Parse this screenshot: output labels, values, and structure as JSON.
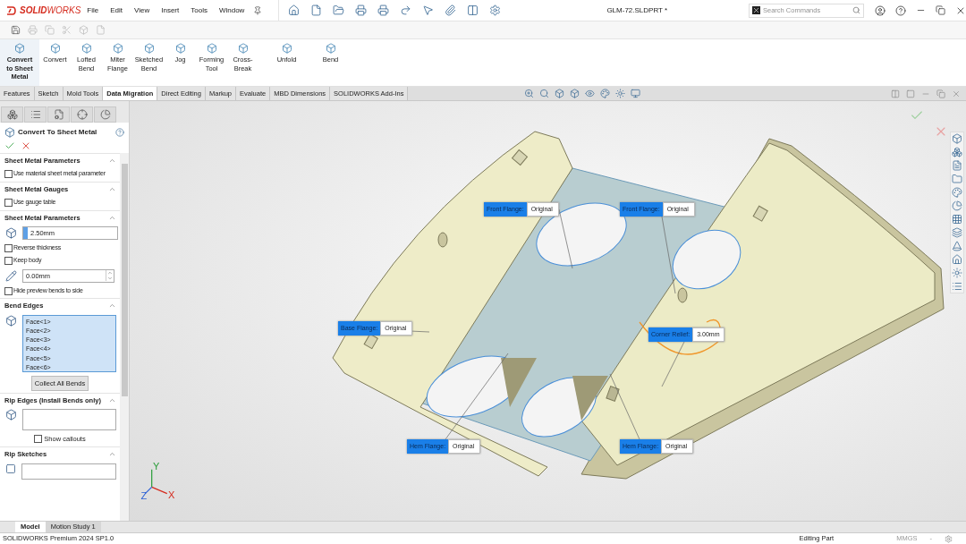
{
  "app": {
    "logo": "**SOLID**WORKS",
    "menu": [
      "File",
      "Edit",
      "View",
      "Insert",
      "Tools",
      "Window"
    ],
    "document_title": "GLM-72.SLDPRT *",
    "search": {
      "placeholder": "Search Commands"
    }
  },
  "ribbon": [
    {
      "label": "Convert to Sheet Metal",
      "selected": true
    },
    {
      "label": "Convert",
      "selected": false
    },
    {
      "label": "Lofted Bend",
      "selected": false
    },
    {
      "label": "Miter Flange",
      "selected": false
    },
    {
      "label": "Sketched Bend",
      "selected": false
    },
    {
      "label": "Jog",
      "selected": false
    },
    {
      "label": "Forming Tool",
      "selected": false
    },
    {
      "label": "Cross-Break",
      "selected": false
    },
    {
      "label": "Unfold",
      "selected": false
    },
    {
      "label": "Bend",
      "selected": false
    }
  ],
  "tabs": [
    {
      "label": "Features",
      "selected": false
    },
    {
      "label": "Sketch",
      "selected": false
    },
    {
      "label": "Mold Tools",
      "selected": false
    },
    {
      "label": "Data Migration",
      "selected": true
    },
    {
      "label": "Direct Editing",
      "selected": false
    },
    {
      "label": "Markup",
      "selected": false
    },
    {
      "label": "Evaluate",
      "selected": false
    },
    {
      "label": "MBD Dimensions",
      "selected": false
    },
    {
      "label": "SOLIDWORKS Add-Ins",
      "selected": false
    }
  ],
  "property_manager": {
    "title": "Convert To Sheet Metal",
    "sections": [
      {
        "title": "Sheet Metal Parameters",
        "expanded": true,
        "rows": [
          {
            "kind": "checkbox",
            "label": "Use material sheet metal parameter",
            "checked": false
          }
        ]
      },
      {
        "title": "Sheet Metal Gauges",
        "expanded": true,
        "rows": [
          {
            "kind": "checkbox",
            "label": "Use gauge table",
            "checked": false
          }
        ]
      },
      {
        "title": "Sheet Metal Parameters",
        "expanded": true,
        "rows": [
          {
            "kind": "field",
            "value": "2.50mm"
          },
          {
            "kind": "checkbox",
            "label": "Reverse thickness",
            "checked": false
          },
          {
            "kind": "checkbox",
            "label": "Keep body",
            "checked": false
          },
          {
            "kind": "spin",
            "value": "0.00mm"
          },
          {
            "kind": "checkbox",
            "label": "Hide preview bends to side",
            "checked": false
          }
        ]
      },
      {
        "title": "Bend Edges",
        "expanded": true,
        "rows": [
          {
            "kind": "list",
            "items": [
              "Face<1>",
              "Face<2>",
              "Face<3>",
              "Face<4>",
              "Face<5>",
              "Face<6>"
            ]
          },
          {
            "kind": "button",
            "label": "Collect All Bends"
          }
        ]
      },
      {
        "title": "Rip Edges (Install Bends only)",
        "expanded": true,
        "rows": [
          {
            "kind": "box"
          },
          {
            "kind": "checkbox_center",
            "label": "Show callouts",
            "checked": false
          }
        ]
      },
      {
        "title": "Rip Sketches",
        "expanded": true,
        "rows": [
          {
            "kind": "sketch_box"
          }
        ]
      }
    ]
  },
  "callouts": [
    {
      "label": "Front Flange:",
      "value": "Original"
    },
    {
      "label": "Front Flange:",
      "value": "Original"
    },
    {
      "label": "Base Flange:",
      "value": "Original"
    },
    {
      "label": "Corner Relief:",
      "value": "3.00mm"
    },
    {
      "label": "Hem Flange:",
      "value": "Original"
    },
    {
      "label": "Hem Flange:",
      "value": "Original"
    }
  ],
  "triad": [
    "Y",
    "X",
    "Z"
  ],
  "bottom_tabs": [
    {
      "label": "Model",
      "selected": true
    },
    {
      "label": "Motion Study 1",
      "selected": false
    }
  ],
  "status_bar": {
    "product": "SOLIDWORKS Premium 2024 SP1.0",
    "mode": "Editing Part",
    "units": "MMGS",
    "separator": "-"
  }
}
